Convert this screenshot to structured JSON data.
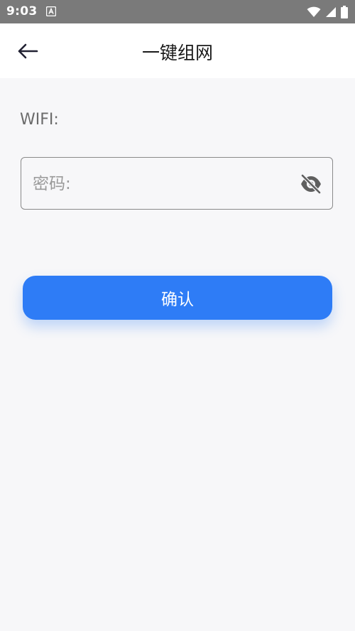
{
  "status_bar": {
    "time": "9:03",
    "notification_icon": "a-app-notification-icon",
    "wifi_icon": "wifi-icon",
    "signal_icon": "cellular-signal-icon",
    "battery_icon": "battery-icon"
  },
  "app_bar": {
    "back_icon": "arrow-left-icon",
    "title": "一键组网"
  },
  "form": {
    "wifi_label": "WIFI:",
    "password_placeholder": "密码:",
    "password_value": "",
    "visibility_icon": "eye-off-icon",
    "confirm_label": "确认"
  },
  "colors": {
    "status_bar": "#7a7a7a",
    "background": "#f7f7f9",
    "primary": "#2e7cf6"
  }
}
